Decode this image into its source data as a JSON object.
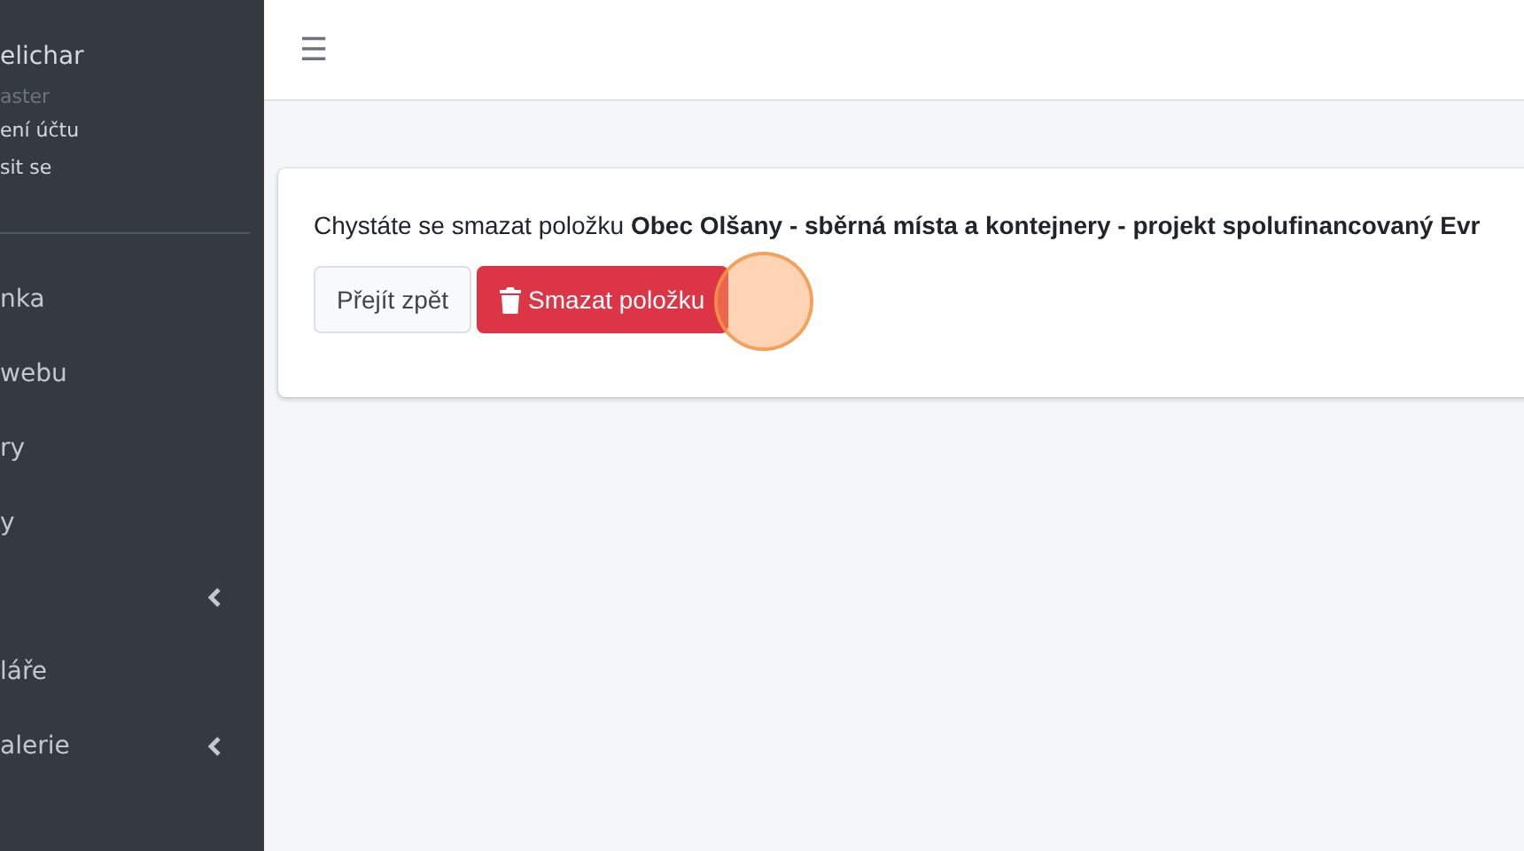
{
  "sidebar": {
    "user": {
      "name": "elichar",
      "role": "aster"
    },
    "user_links": [
      "ení účtu",
      "sit se"
    ],
    "items": [
      {
        "label": "nka",
        "expandable": false
      },
      {
        "label": "webu",
        "expandable": false
      },
      {
        "label": "ry",
        "expandable": false
      },
      {
        "label": "y",
        "expandable": false
      },
      {
        "expandable": true
      },
      {
        "label": "láře",
        "expandable": false
      },
      {
        "label": "alerie",
        "expandable": true
      }
    ]
  },
  "topbar": {
    "menu_icon": "☰"
  },
  "card": {
    "message": "Chystáte se smazat položku **Obec Olšany - sběrná místa a kontejnery - projekt spolufinancovaný Evr**",
    "buttons": [
      {
        "label": "Přejít zpět",
        "kind": "secondary"
      },
      {
        "label": "Smazat položku",
        "kind": "danger"
      }
    ]
  }
}
